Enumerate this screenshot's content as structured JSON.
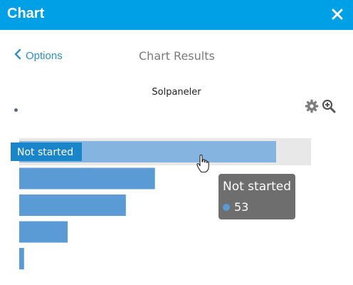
{
  "window": {
    "title": "Chart",
    "close_icon": "close-icon"
  },
  "nav": {
    "back_label": "Options",
    "title": "Chart Results"
  },
  "toolbar": {
    "settings_icon": "gear-icon",
    "zoom_icon": "zoom-in-icon"
  },
  "colors": {
    "header": "#00a0e6",
    "bar": "#5b9bd5",
    "bar_highlight": "#86b4e0",
    "label_bg": "#1a85c8",
    "tooltip_bg": "#6e6e6e"
  },
  "chart_data": {
    "type": "bar",
    "orientation": "horizontal",
    "title": "Solpaneler",
    "categories": [
      "Not started",
      "",
      "",
      "",
      ""
    ],
    "values": [
      53,
      28,
      22,
      10,
      1
    ],
    "highlighted_index": 0,
    "highlight_label": "Not started",
    "tooltip": {
      "category": "Not started",
      "value": "53"
    }
  }
}
